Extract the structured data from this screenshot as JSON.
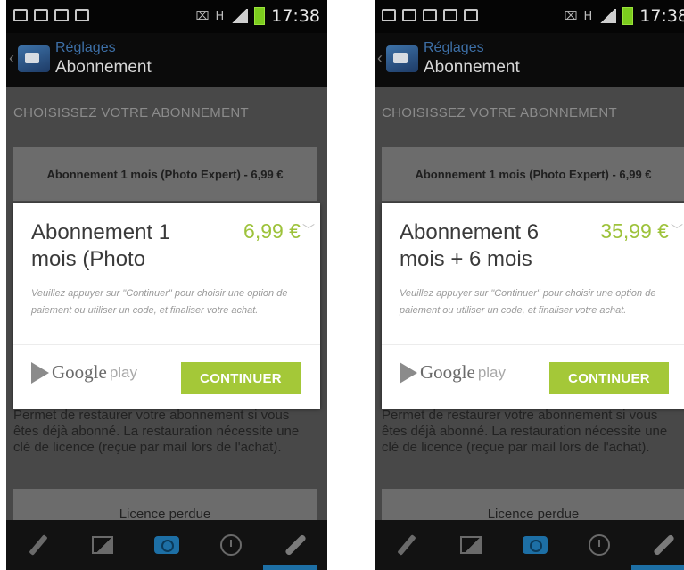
{
  "status_bar": {
    "time": "17:38",
    "h_label": "H"
  },
  "action_bar": {
    "title": "Réglages",
    "subtitle": "Abonnement"
  },
  "section_title": "CHOISISSEZ VOTRE ABONNEMENT",
  "subscription_button": "Abonnement 1 mois (Photo Expert) - 6,99 €",
  "body_text": "Permet de restaurer votre abonnement si vous êtes déjà abonné. La restauration nécessite une clé de licence (reçue par mail lors de l'achat).",
  "lost_license_button": "Licence perdue",
  "dialog_text": "Veuillez appuyer sur \"Continuer\" pour choisir une option de paiement ou utiliser un code, et finaliser votre achat.",
  "google_play": {
    "google": "Google",
    "play": "play"
  },
  "continue_label": "CONTINUER",
  "dialog_left": {
    "title": "Abonnement 1 mois (Photo",
    "price": "6,99 €"
  },
  "dialog_right": {
    "title": "Abonnement 6 mois + 6 mois",
    "price": "35,99 €"
  },
  "colors": {
    "accent_green": "#a4c838",
    "price_green": "#9dc23a",
    "holo_blue": "#1d6fa5"
  },
  "nav_icons": [
    "pencil-icon",
    "image-icon",
    "camera-icon",
    "clock-icon",
    "wrench-icon"
  ]
}
